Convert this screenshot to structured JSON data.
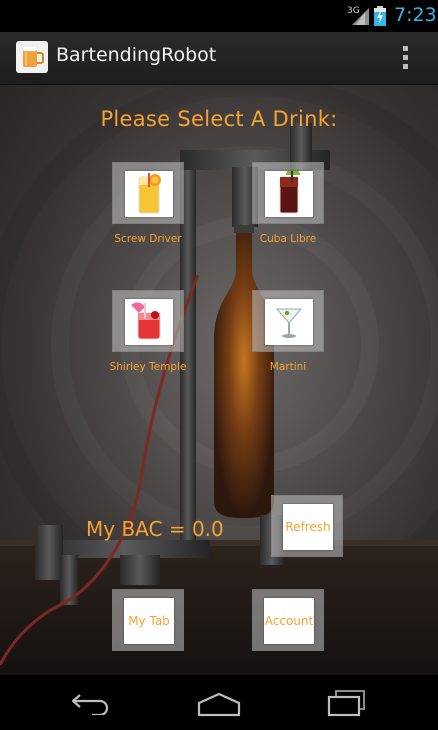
{
  "status_bar": {
    "network": "3G",
    "time": "7:23",
    "signal_icon": "signal-icon",
    "battery_icon": "battery-charging-icon",
    "clock_color": "#33b5e5"
  },
  "action_bar": {
    "title": "BartendingRobot",
    "app_icon": "beer-mug-icon",
    "menu_icon": "overflow-menu-icon"
  },
  "main": {
    "prompt": "Please Select A Drink:",
    "drinks": [
      {
        "label": "Screw Driver",
        "icon": "screwdriver-glass-icon"
      },
      {
        "label": "Cuba Libre",
        "icon": "cuba-libre-glass-icon"
      },
      {
        "label": "Shirley Temple",
        "icon": "shirley-temple-glass-icon"
      },
      {
        "label": "Martini",
        "icon": "martini-glass-icon"
      }
    ],
    "bac_text": "My BAC = 0.0",
    "buttons": {
      "refresh": "Refresh",
      "my_tab": "My Tab",
      "account": "Account"
    }
  },
  "nav_bar": {
    "back_icon": "back-icon",
    "home_icon": "home-icon",
    "recents_icon": "recent-apps-icon"
  },
  "colors": {
    "accent": "#f7a332",
    "status_clock": "#33b5e5"
  }
}
